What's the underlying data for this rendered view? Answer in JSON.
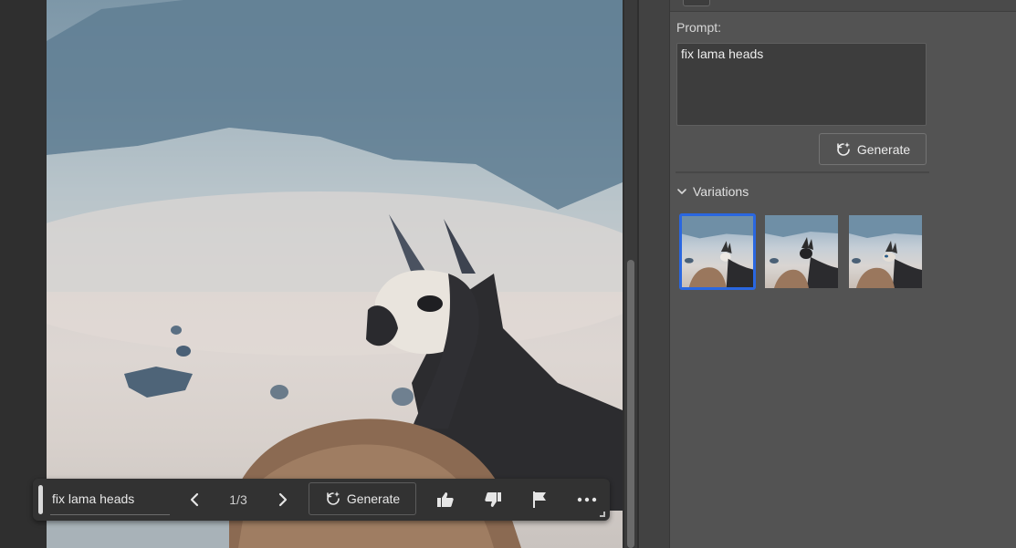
{
  "taskbar": {
    "prompt_value": "fix lama heads",
    "page_counter": "1/3",
    "generate_label": "Generate",
    "icons": {
      "prev": "chevron-left-icon",
      "next": "chevron-right-icon",
      "generate": "refresh-sparkle-icon",
      "thumbs_up": "thumbs-up-icon",
      "thumbs_down": "thumbs-down-icon",
      "flag": "flag-icon",
      "more": "ellipsis-icon"
    }
  },
  "properties_panel": {
    "prompt_label": "Prompt:",
    "prompt_value": "fix lama heads",
    "generate_label": "Generate",
    "variations_label": "Variations",
    "variations": [
      {
        "selected": true
      },
      {
        "selected": false
      },
      {
        "selected": false
      }
    ]
  },
  "colors": {
    "accent_selected": "#2a67e0",
    "panel_bg": "#535353",
    "canvas_bg": "#2f2f2f",
    "taskbar_bg": "#323232"
  }
}
